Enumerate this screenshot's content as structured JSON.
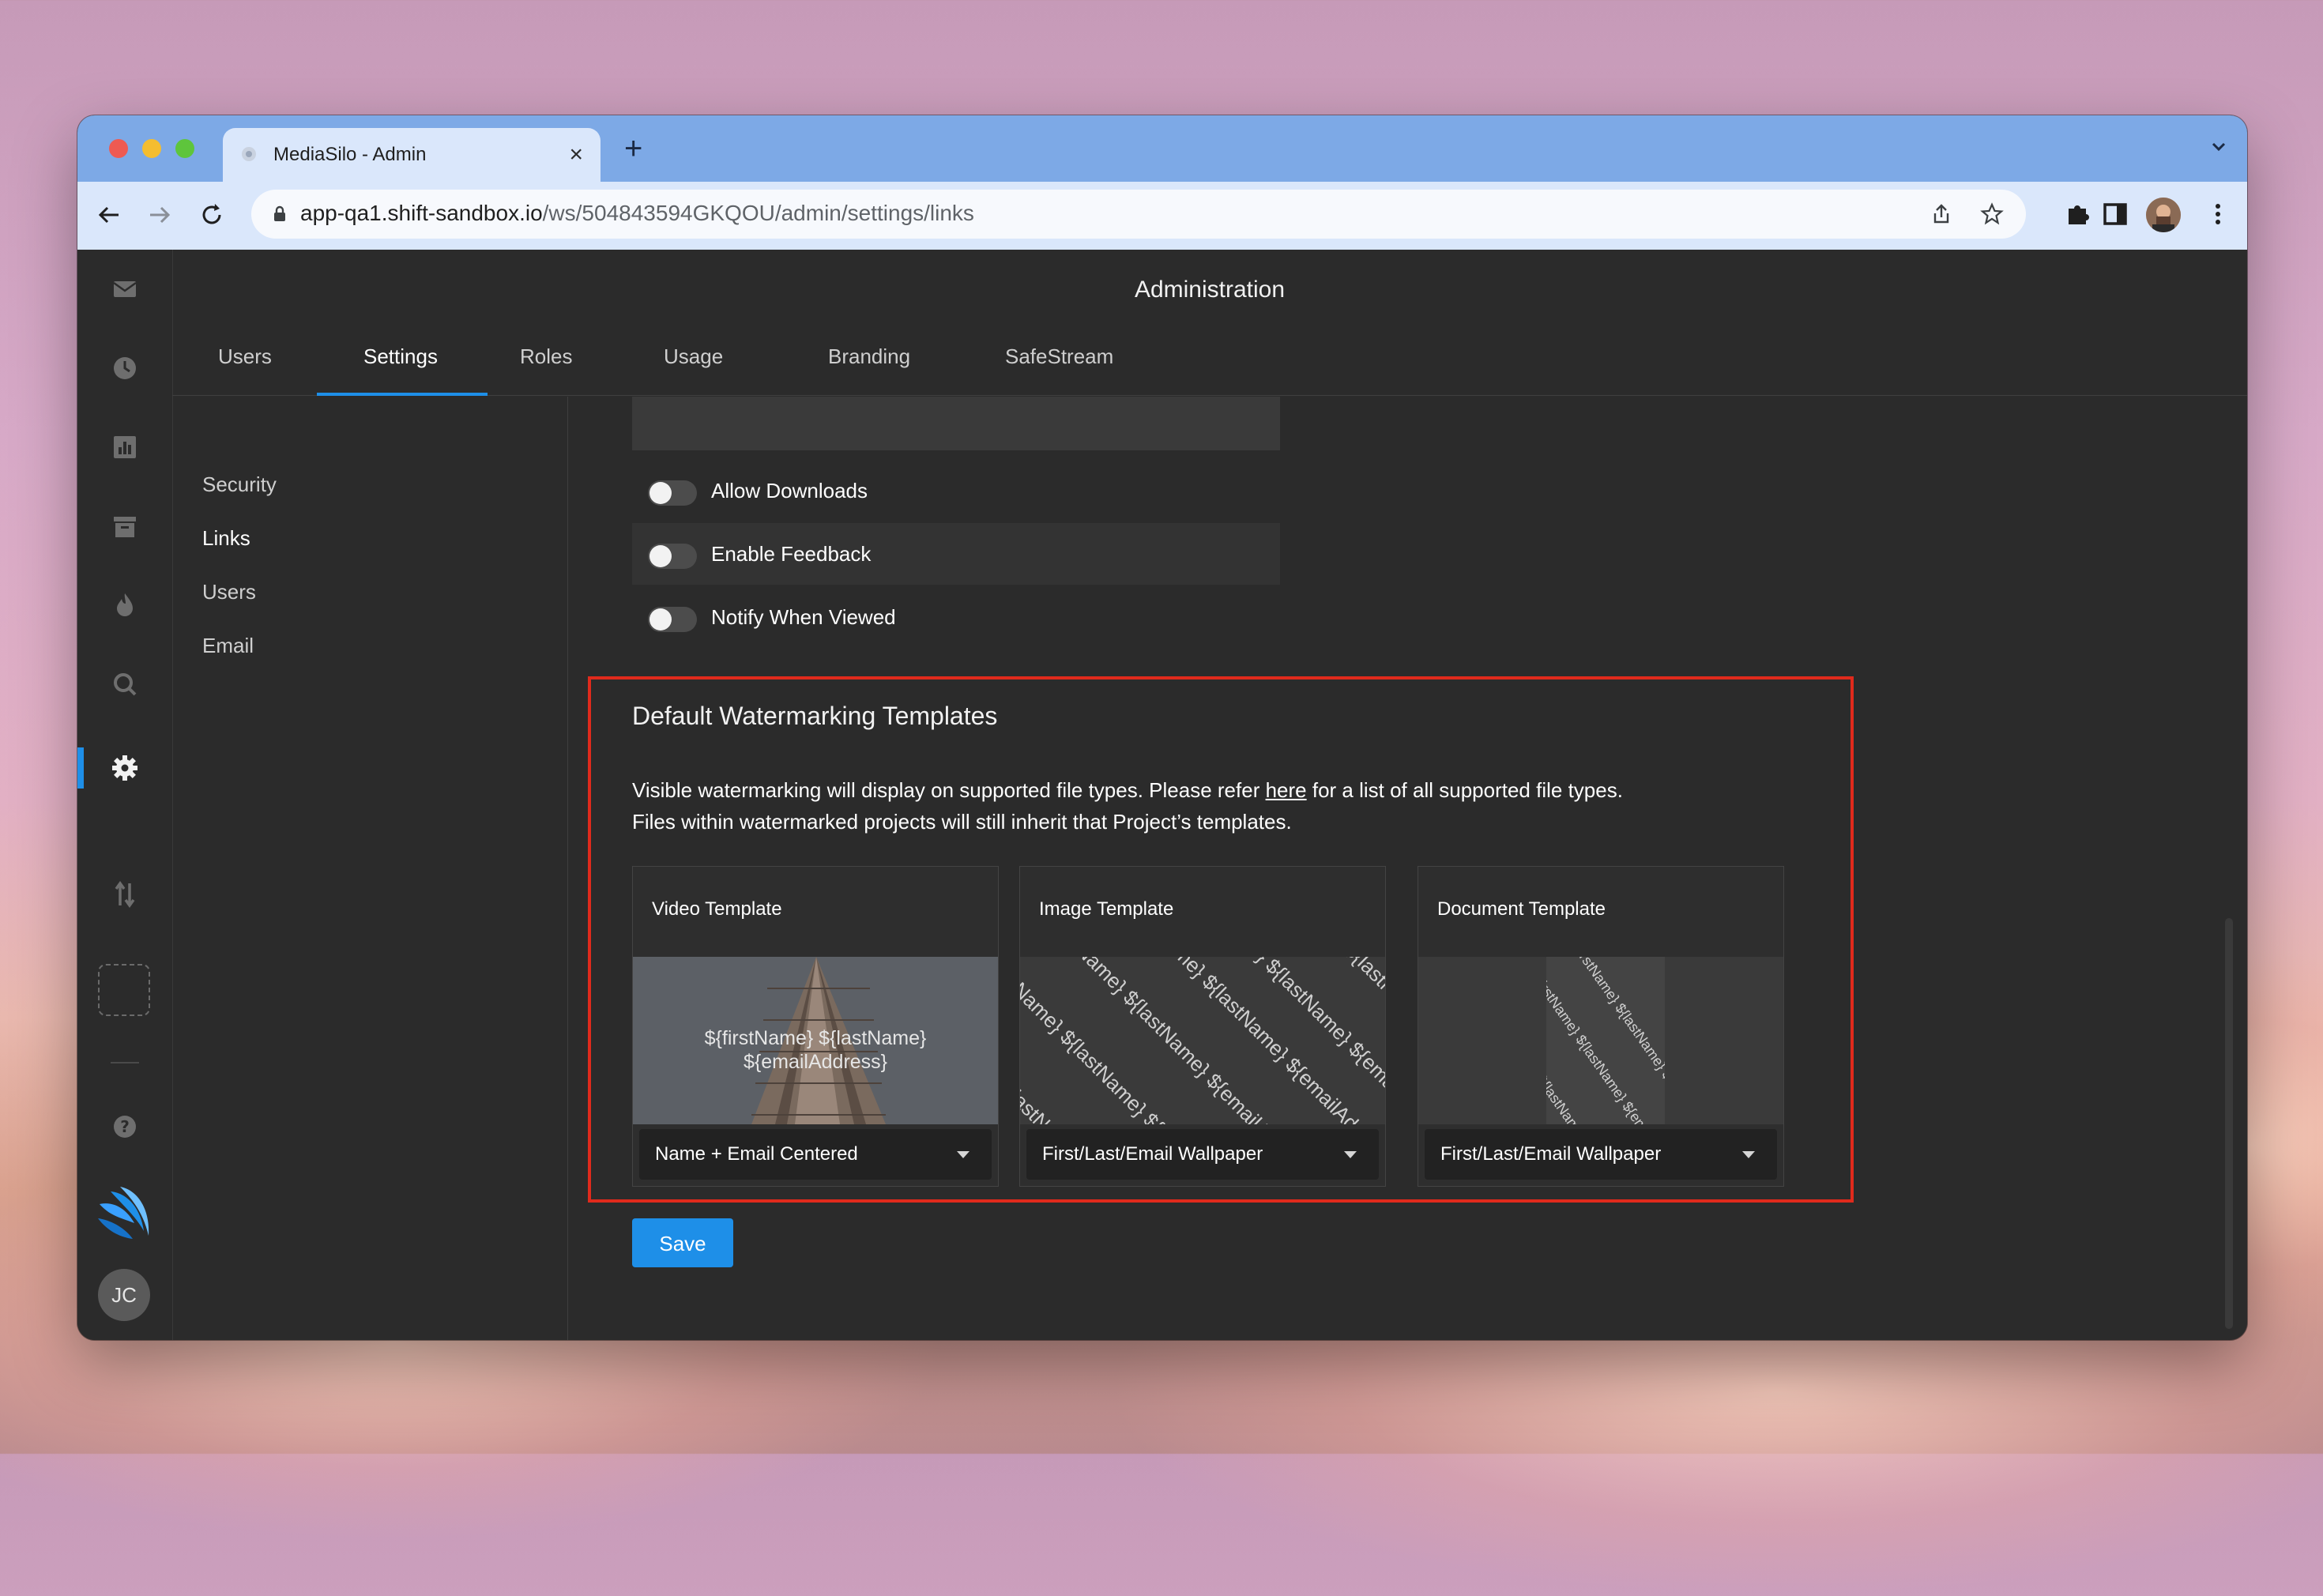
{
  "browser": {
    "tab_title": "MediaSilo - Admin",
    "url_host": "app-qa1.shift-sandbox.io",
    "url_path": "/ws/504843594GKQOU/admin/settings/links"
  },
  "app": {
    "page_title": "Administration",
    "tabs": [
      {
        "label": "Users"
      },
      {
        "label": "Settings"
      },
      {
        "label": "Roles"
      },
      {
        "label": "Usage"
      },
      {
        "label": "Branding"
      },
      {
        "label": "SafeStream"
      }
    ],
    "active_tab": "Settings",
    "subnav": [
      {
        "label": "Security"
      },
      {
        "label": "Links"
      },
      {
        "label": "Users"
      },
      {
        "label": "Email"
      }
    ],
    "active_subnav": "Links",
    "user_initials": "JC"
  },
  "toggles": [
    {
      "label": "Allow Downloads",
      "on": false
    },
    {
      "label": "Enable Feedback",
      "on": false
    },
    {
      "label": "Notify When Viewed",
      "on": false
    }
  ],
  "watermark": {
    "title": "Default Watermarking Templates",
    "desc_before_link": "Visible watermarking will display on supported file types. Please refer ",
    "link_text": "here",
    "desc_after_link": " for a list of all supported file types.",
    "desc_line2": "Files within watermarked projects will still inherit that Project’s templates.",
    "highlight_color": "#e02a1c",
    "cards": [
      {
        "title": "Video Template",
        "preview_line1": "${firstName} ${lastName}",
        "preview_line2": "${emailAddress}",
        "selected": "Name + Email Centered"
      },
      {
        "title": "Image Template",
        "wallpaper_text": "${firstName} ${lastName} ${emailAddress}",
        "selected": "First/Last/Email Wallpaper"
      },
      {
        "title": "Document Template",
        "wallpaper_text": "${firstName} ${lastName} ${emailAddress}",
        "selected": "First/Last/Email Wallpaper"
      }
    ]
  },
  "save_label": "Save",
  "accent_color": "#1e8fe8"
}
